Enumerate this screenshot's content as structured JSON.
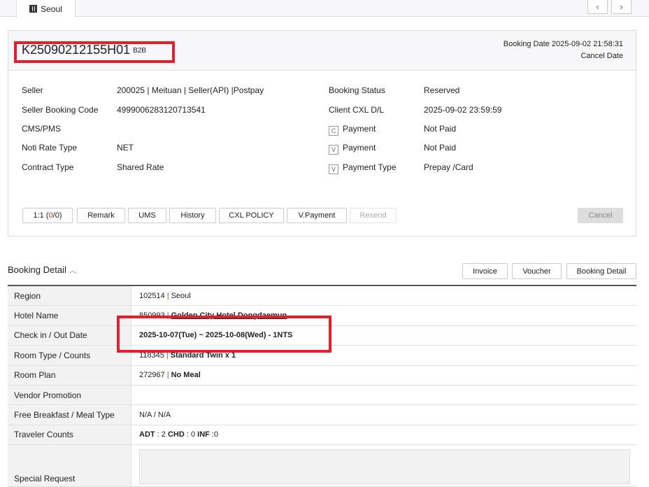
{
  "tab": {
    "label": "Seoul",
    "prev": "‹",
    "next": "›"
  },
  "header": {
    "booking_id": "K25090212155H01",
    "channel": "B2B",
    "booking_date": "Booking Date 2025-09-02 21:58:31",
    "cancel_date": "Cancel Date"
  },
  "info_left": [
    {
      "label": "Seller",
      "value": "200025 | Meituan | Seller(API) |Postpay"
    },
    {
      "label": "Seller Booking Code",
      "value": "4999006283120713541"
    },
    {
      "label": "CMS/PMS",
      "value": ""
    },
    {
      "label": "Noti Rate Type",
      "value": "NET"
    },
    {
      "label": "Contract Type",
      "value": "Shared Rate"
    }
  ],
  "info_right": [
    {
      "label": "Booking Status",
      "value": "Reserved"
    },
    {
      "label": "Client CXL D/L",
      "value": "2025-09-02 23:59:59"
    },
    {
      "badge": "C",
      "label": "Payment",
      "value": "Not Paid"
    },
    {
      "badge": "V",
      "label": "Payment",
      "value": "Not Paid"
    },
    {
      "badge": "V",
      "label": "Payment Type",
      "value": "Prepay /Card"
    }
  ],
  "buttons": {
    "one_to_one": "1:1 (",
    "count_a": "0",
    "count_b": "/0)",
    "remark": "Remark",
    "ums": "UMS",
    "history": "History",
    "cxl_policy": "CXL POLICY",
    "v_payment": "V.Payment",
    "resend": "Resend",
    "cancel": "Cancel"
  },
  "detail": {
    "title": "Booking Detail",
    "invoice": "Invoice",
    "voucher": "Voucher",
    "booking_detail": "Booking Detail",
    "region_code": "102514",
    "region": "Seoul",
    "hotel_code": "850993",
    "hotel": "Golden City Hotel Dongdaemun",
    "dates": "2025-10-07(Tue) ~ 2025-10-08(Wed) - 1NTS",
    "room_code": "118345",
    "room": "Standard Twin x 1",
    "plan_code": "272967",
    "plan": "No Meal",
    "breakfast": "N/A / N/A",
    "adt_l": "ADT",
    "adt": " : 2 ",
    "chd_l": "CHD",
    "chd": " : 0 ",
    "inf_l": "INF",
    "inf": " :0",
    "labels": [
      "Region",
      "Hotel Name",
      "Check in / Out Date",
      "Room Type / Counts",
      "Room Plan",
      "Vendor Promotion",
      "Free Breakfast / Meal Type",
      "Traveler Counts",
      "Special Request"
    ]
  }
}
